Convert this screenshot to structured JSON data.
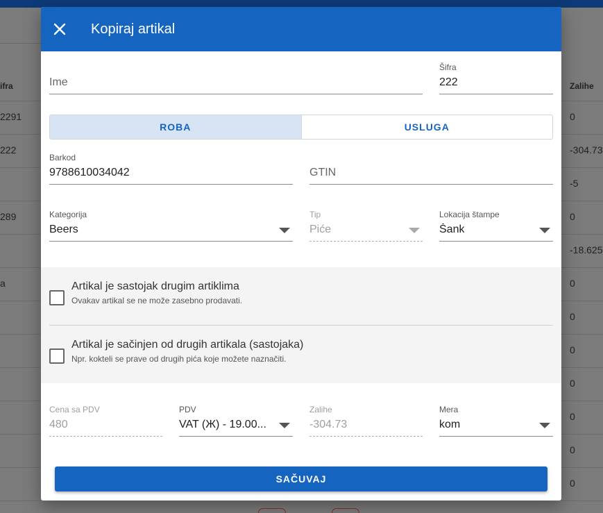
{
  "background": {
    "left_header": "ifra",
    "right_header": "Zalihe",
    "left_rows": [
      "2291",
      "222",
      "",
      "289",
      "",
      "a",
      "",
      "",
      "",
      "",
      "",
      ""
    ],
    "right_rows": [
      "0",
      "-304.73",
      "-5",
      "0",
      "-18.625",
      "0",
      "0",
      "0",
      "0",
      "0",
      "0",
      "0"
    ]
  },
  "dialog": {
    "title": "Kopiraj artikal",
    "close_icon": "close-icon",
    "name": {
      "placeholder": "Ime",
      "value": ""
    },
    "code": {
      "label": "Šifra",
      "value": "222"
    },
    "type_toggle": {
      "options": [
        "ROBA",
        "USLUGA"
      ],
      "selected": "ROBA"
    },
    "barcode": {
      "label": "Barkod",
      "value": "9788610034042"
    },
    "gtin": {
      "placeholder": "GTIN",
      "value": ""
    },
    "category": {
      "label": "Kategorija",
      "value": "Beers"
    },
    "tip": {
      "label": "Tip",
      "value": "Piće",
      "disabled": true
    },
    "print_location": {
      "label": "Lokacija štampe",
      "value": "Šank"
    },
    "ingredient_check": {
      "title": "Artikal je sastojak drugim artiklima",
      "subtitle": "Ovakav artikal se ne može zasebno prodavati.",
      "checked": false
    },
    "composite_check": {
      "title": "Artikal je sačinjen od drugih artikala (sastojaka)",
      "subtitle": "Npr. kokteli se prave od drugih pića koje možete naznačiti.",
      "checked": false
    },
    "price": {
      "label": "Cena sa PDV",
      "value": "480",
      "disabled": true
    },
    "vat": {
      "label": "PDV",
      "value": "VAT (Ж) - 19.00..."
    },
    "stock": {
      "label": "Zalihe",
      "value": "-304.73",
      "disabled": true
    },
    "unit": {
      "label": "Mera",
      "value": "kom"
    },
    "save_label": "SAČUVAJ"
  },
  "colors": {
    "primary": "#1565c0",
    "toggle_active_bg": "#d6e4f4",
    "section_bg": "#f4f4f4"
  }
}
